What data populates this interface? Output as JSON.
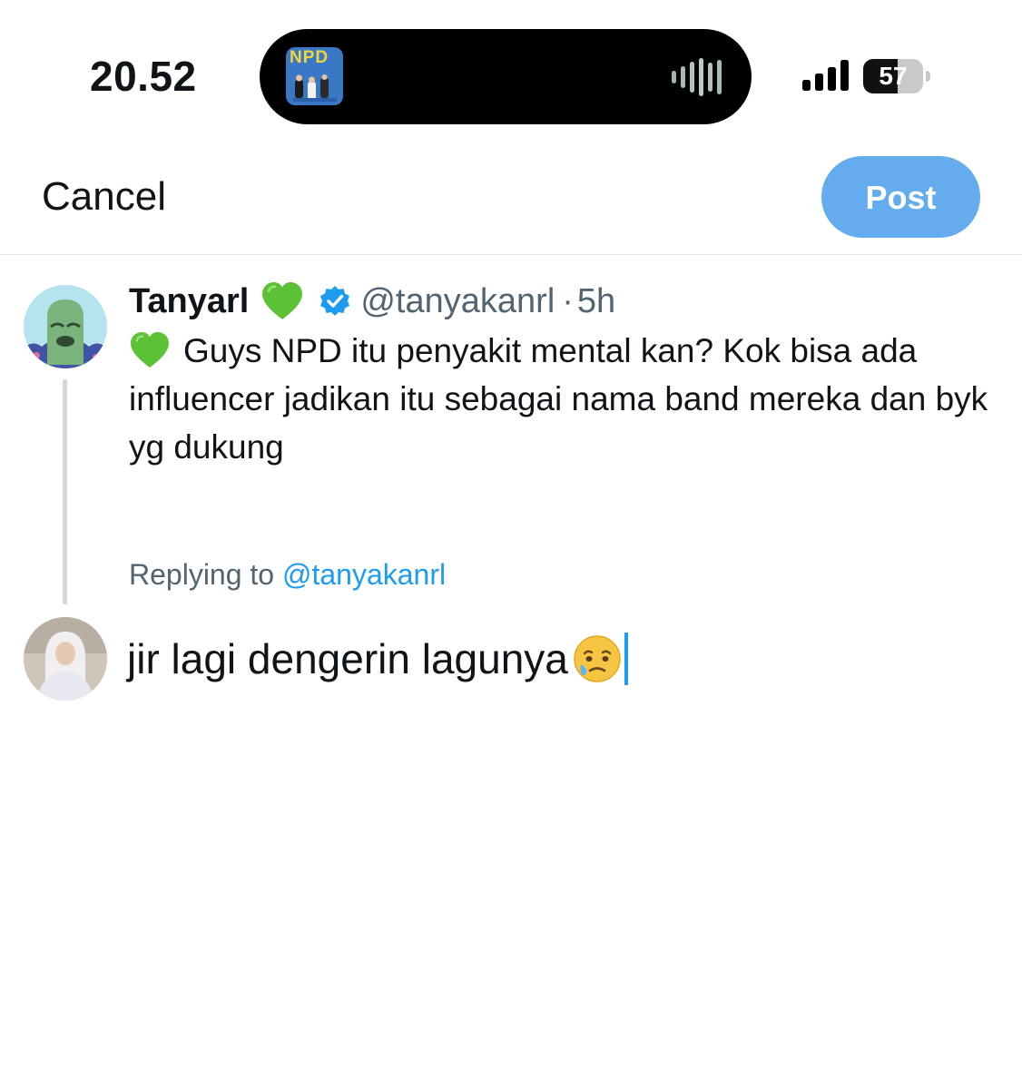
{
  "status_bar": {
    "time": "20.52",
    "battery_level": "57",
    "battery_fraction": 0.57,
    "now_playing_art_text": "NPD"
  },
  "compose": {
    "cancel_label": "Cancel",
    "post_label": "Post"
  },
  "original_tweet": {
    "display_name": "Tanyarl",
    "handle": "@tanyakanrl",
    "separator": "·",
    "time": "5h",
    "text": "Guys NPD itu penyakit mental kan? Kok bisa ada influencer jadikan itu sebagai nama band mereka dan byk yg dukung"
  },
  "replying": {
    "prefix": "Replying to",
    "handle": "@tanyakanrl"
  },
  "reply": {
    "text": "jir lagi dengerin lagunya"
  },
  "colors": {
    "accent": "#1d9bf0",
    "post_button": "#64acee",
    "secondary_text": "#536471",
    "heart_green": "#5bc236"
  },
  "icons": {
    "heart": "green-heart-icon",
    "verified": "verified-badge-icon",
    "reply_emoji": "face-holding-back-tears-icon"
  }
}
